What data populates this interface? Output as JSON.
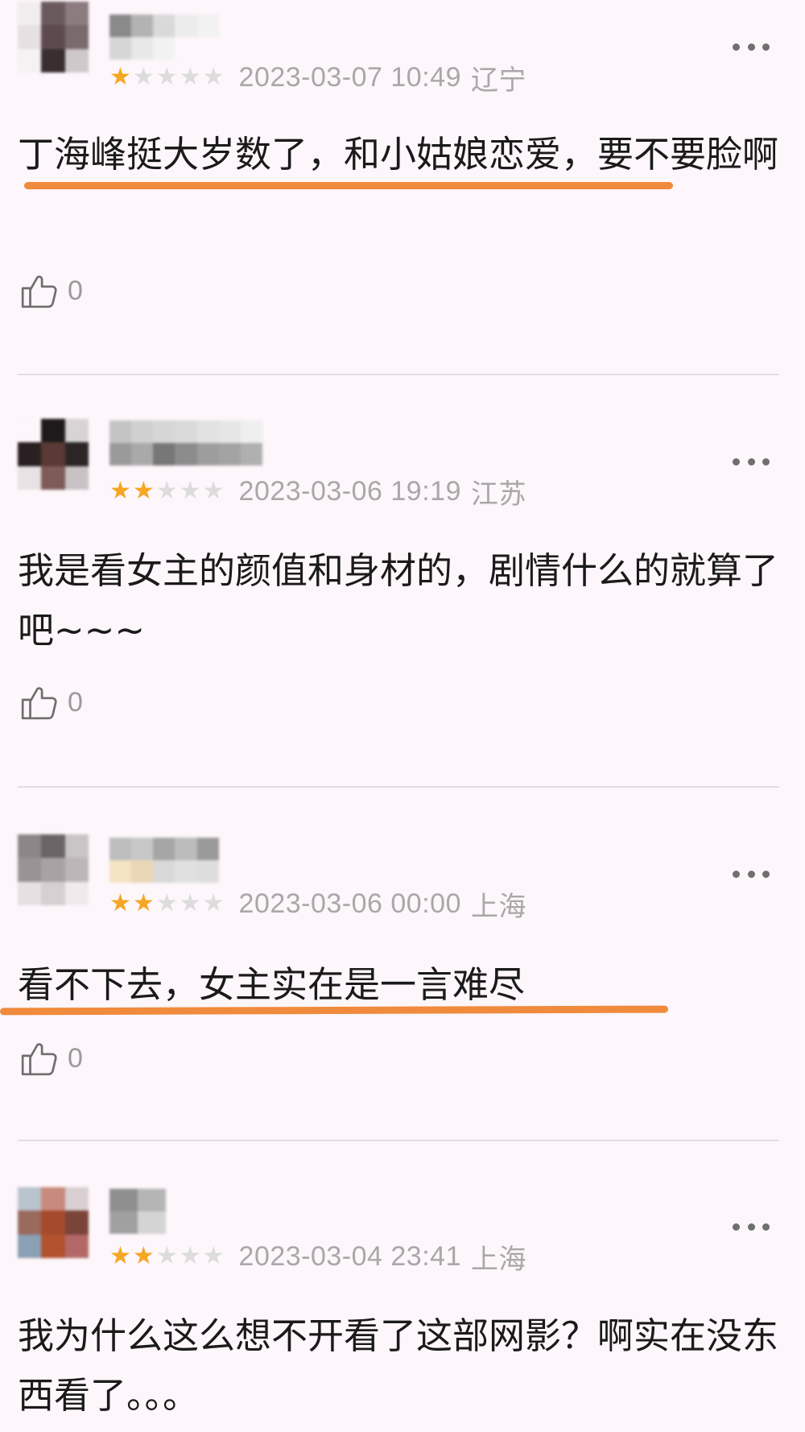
{
  "reviews": [
    {
      "stars": 1,
      "date": "2023-03-07 10:49",
      "location": "辽宁",
      "text": "丁海峰挺大岁数了，和小姑娘恋爱，要不要脸啊",
      "likes": "0"
    },
    {
      "stars": 2,
      "date": "2023-03-06 19:19",
      "location": "江苏",
      "text": "我是看女主的颜值和身材的，剧情什么的就算了吧~~~",
      "likes": "0"
    },
    {
      "stars": 2,
      "date": "2023-03-06 00:00",
      "location": "上海",
      "text": "看不下去，女主实在是一言难尽",
      "likes": "0"
    },
    {
      "stars": 2,
      "date": "2023-03-04 23:41",
      "location": "上海",
      "text": "我为什么这么想不开看了这部网影？啊实在没东西看了。。。",
      "likes": null
    }
  ],
  "colors": {
    "star_on": "#f5a623",
    "star_off": "#dcdcdc",
    "highlight": "#f08a3c",
    "background": "#fdf6fa"
  },
  "icons": {
    "like": "thumbs-up-icon",
    "more": "more-dots-icon"
  }
}
